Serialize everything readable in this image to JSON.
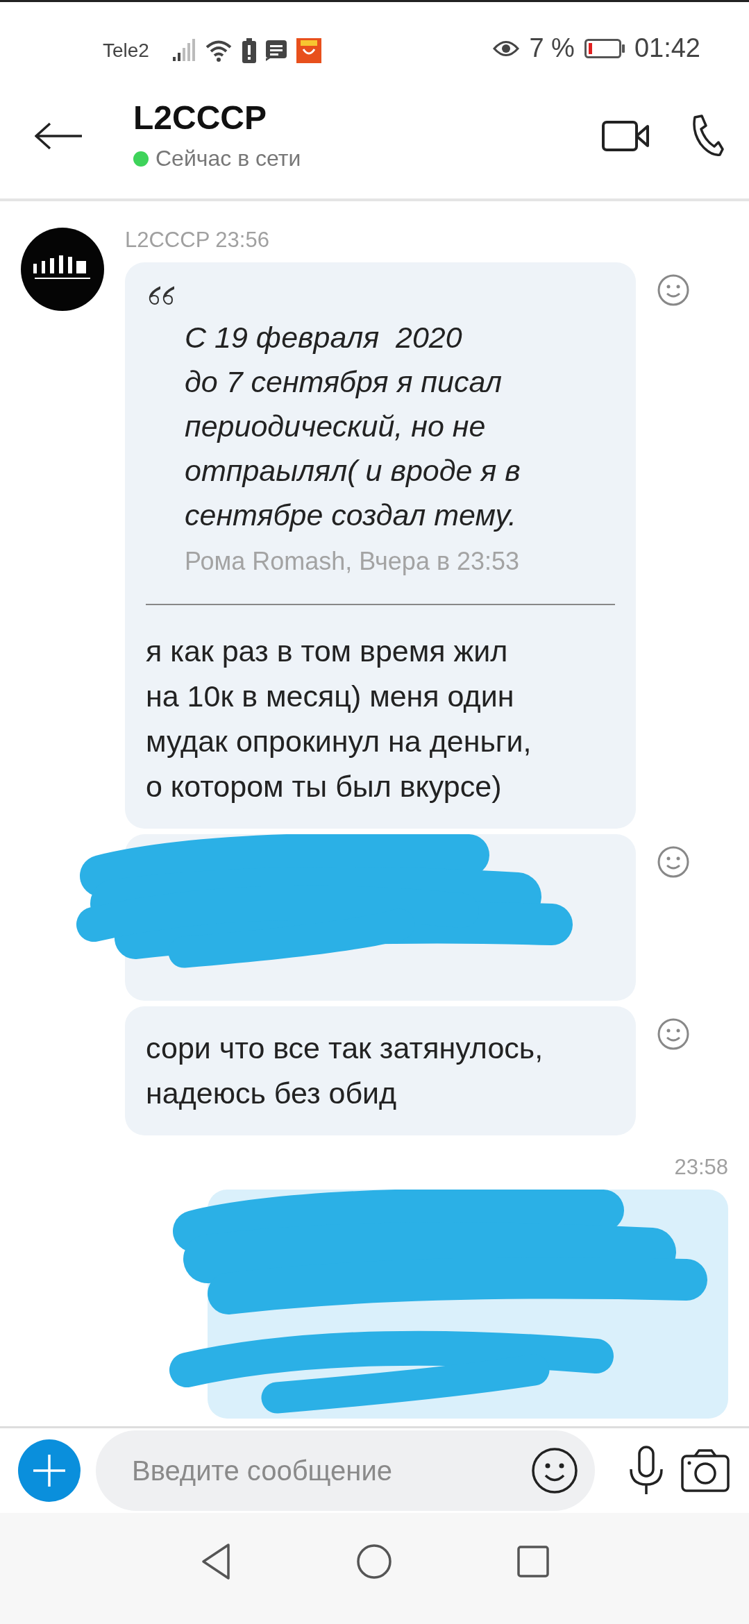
{
  "status_bar": {
    "carrier": "Tele2",
    "battery": "7 %",
    "time": "01:42"
  },
  "header": {
    "title": "L2CCCP",
    "presence": "Сейчас в сети",
    "online": true
  },
  "groups": [
    {
      "kind": "incoming",
      "meta": "L2CCCP 23:56",
      "bubbles": [
        {
          "kind": "quote_reply",
          "quote": "С 19 февраля  2020\nдо 7 сентября я писал\nпериодический, но не\nотпраылял( и вроде я в\nсентябре создал тему.",
          "source": "Рома Romash, Вчера в 23:53",
          "text": "я как раз в том время жил\nна 10к в месяц) меня один\nмудак опрокинул на деньги,\nо котором ты был вкурсе)"
        },
        {
          "kind": "redacted"
        },
        {
          "kind": "text",
          "text": "сори что все так затянулось,\nнадеюсь без обид"
        }
      ]
    },
    {
      "kind": "outgoing",
      "meta": "23:58",
      "bubbles": [
        {
          "kind": "redacted"
        }
      ]
    }
  ],
  "composer": {
    "placeholder": "Введите сообщение"
  }
}
